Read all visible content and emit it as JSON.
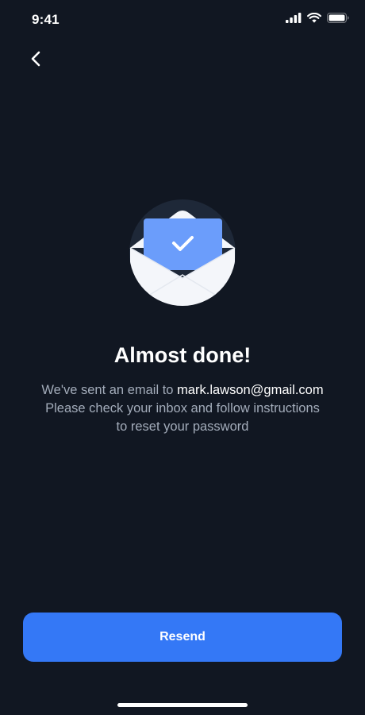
{
  "status_bar": {
    "time": "9:41",
    "icons": [
      "cellular-signal-icon",
      "wifi-icon",
      "battery-icon"
    ]
  },
  "navigation": {
    "back_icon": "chevron-left-icon"
  },
  "illustration": {
    "icon": "envelope-check-icon"
  },
  "content": {
    "title": "Almost done!",
    "message_prefix": "We've sent an email to ",
    "email": "mark.lawson@gmail.com",
    "message_line2": "Please check your inbox and follow instructions",
    "message_line3": "to reset your password"
  },
  "actions": {
    "resend_label": "Resend"
  },
  "colors": {
    "background": "#111722",
    "accent": "#3478f6",
    "envelope_letter": "#6b9dfb",
    "circle_background": "#1e2838",
    "secondary_text": "#a3acba",
    "primary_text": "#ffffff"
  }
}
